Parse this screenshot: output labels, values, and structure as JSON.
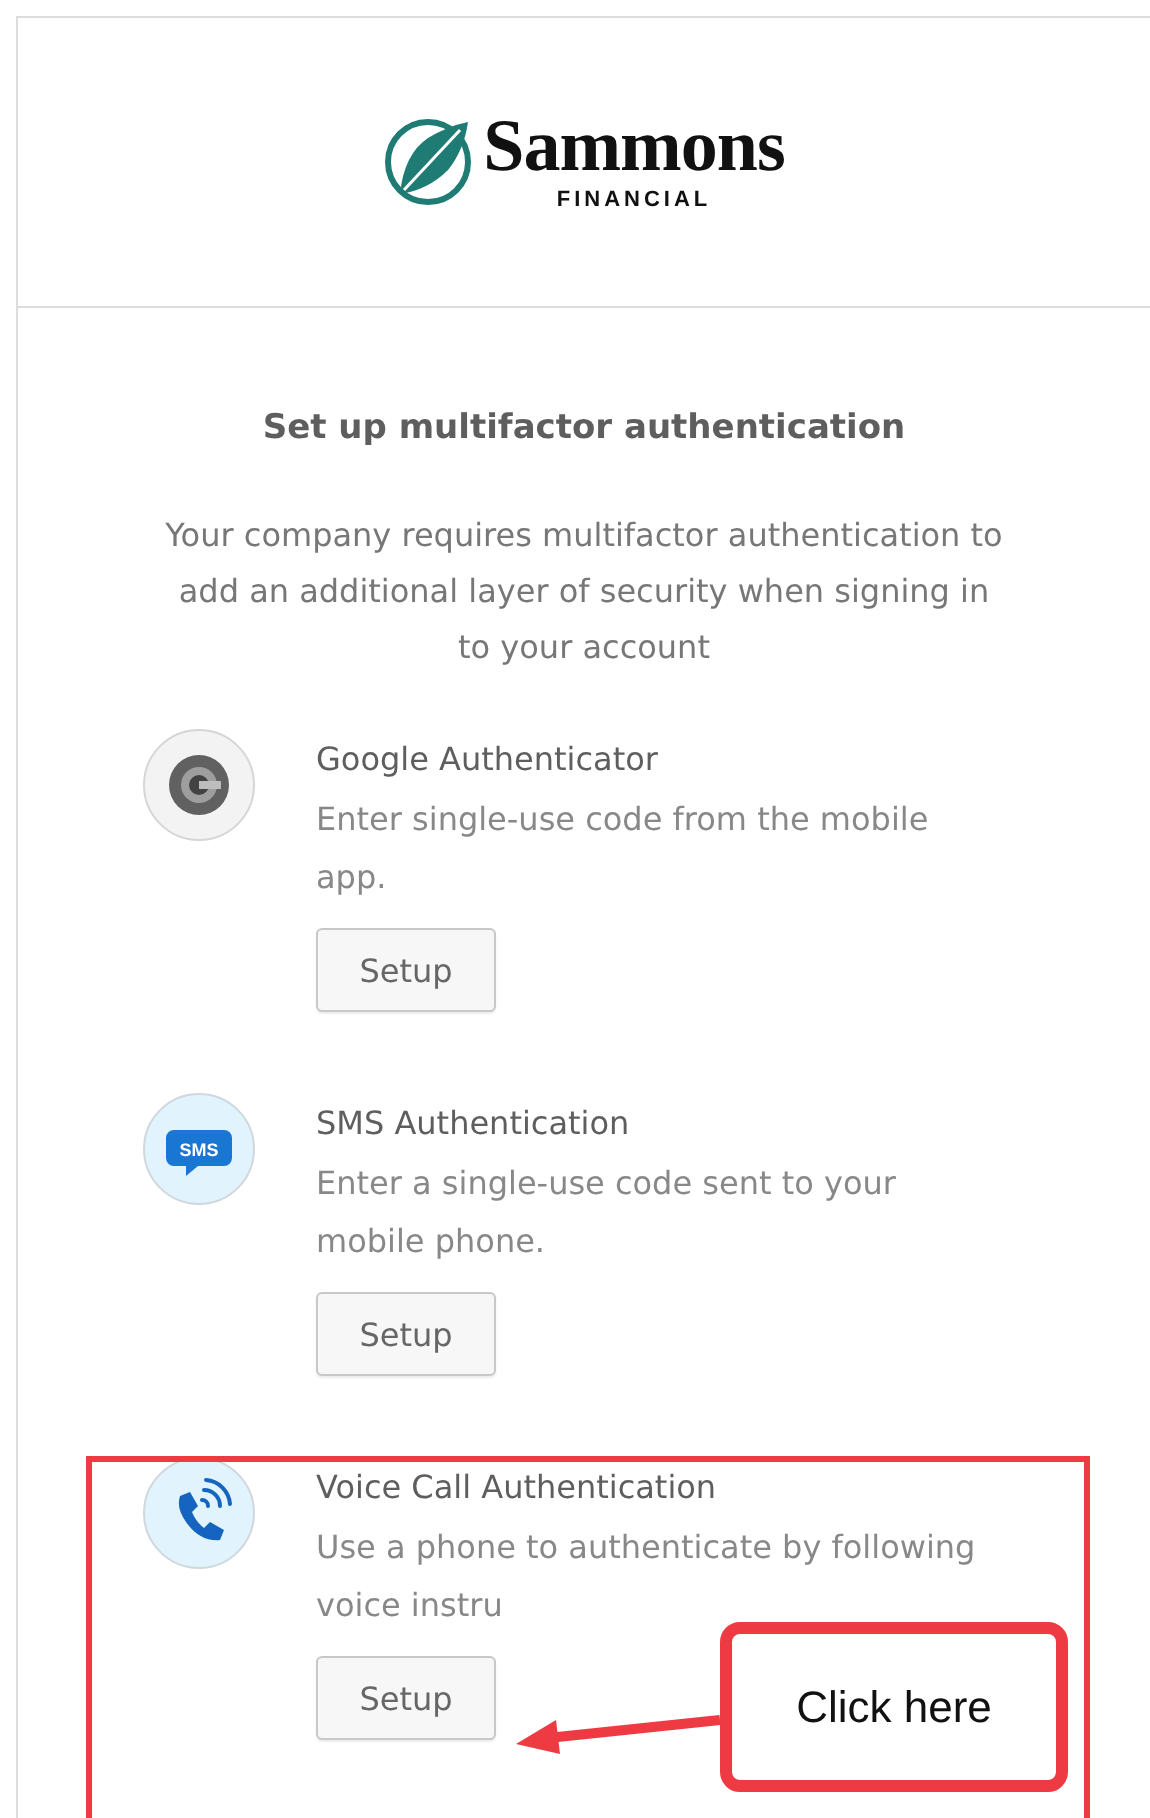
{
  "logo": {
    "name": "Sammons",
    "sub": "FINANCIAL"
  },
  "title": "Set up multifactor authentication",
  "description": "Your company requires multifactor authentication to add an additional layer of security when signing in to your account",
  "factors": [
    {
      "kind": "google",
      "title": "Google Authenticator",
      "description": "Enter single-use code from the mobile app.",
      "button": "Setup"
    },
    {
      "kind": "sms",
      "icon_label": "SMS",
      "title": "SMS Authentication",
      "description": "Enter a single-use code sent to your mobile phone.",
      "button": "Setup"
    },
    {
      "kind": "voice",
      "title": "Voice Call Authentication",
      "description": "Use a phone to authenticate by following voice instru",
      "button": "Setup"
    }
  ],
  "annotation": {
    "callout": "Click here"
  }
}
